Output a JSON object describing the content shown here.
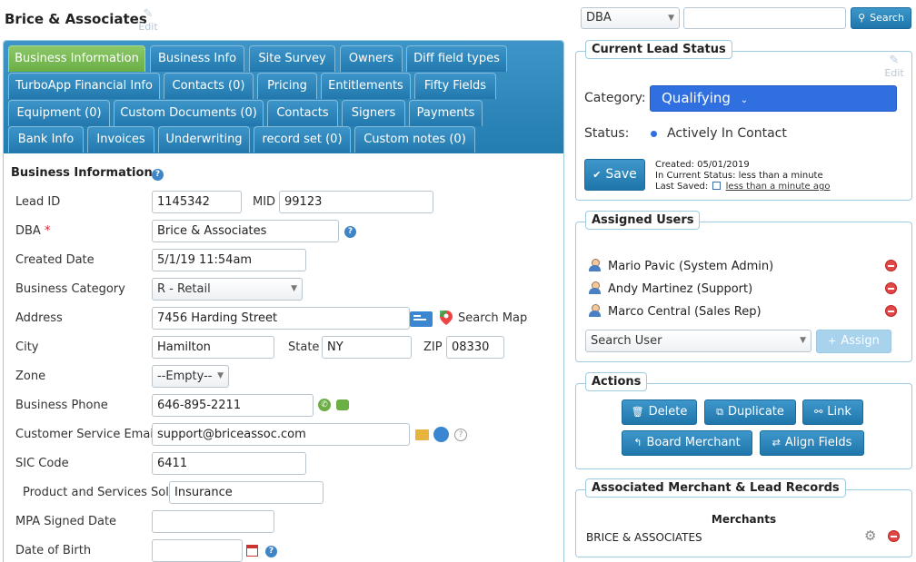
{
  "page": {
    "title": "Brice & Associates",
    "edit_label": "Edit"
  },
  "tabs": [
    {
      "label": "Business Information",
      "active": true
    },
    {
      "label": "Business Info"
    },
    {
      "label": "Site Survey"
    },
    {
      "label": "Owners"
    },
    {
      "label": "Diff field types"
    },
    {
      "label": "TurboApp Financial Info"
    },
    {
      "label": "Contacts (0)"
    },
    {
      "label": "Pricing"
    },
    {
      "label": "Entitlements"
    },
    {
      "label": "Fifty Fields"
    },
    {
      "label": "Equipment (0)"
    },
    {
      "label": "Custom Documents (0)"
    },
    {
      "label": "Contacts"
    },
    {
      "label": "Signers"
    },
    {
      "label": "Payments"
    },
    {
      "label": "Bank Info"
    },
    {
      "label": "Invoices"
    },
    {
      "label": "Underwriting"
    },
    {
      "label": "record set (0)"
    },
    {
      "label": "Custom notes (0)"
    }
  ],
  "form": {
    "section_title": "Business Information",
    "lead_id": {
      "label": "Lead ID",
      "value": "1145342"
    },
    "mid": {
      "label": "MID",
      "value": "99123"
    },
    "dba": {
      "label": "DBA",
      "required_mark": "*",
      "value": "Brice & Associates"
    },
    "created_date": {
      "label": "Created Date",
      "value": "5/1/19 11:54am"
    },
    "business_category": {
      "label": "Business Category",
      "value": "R - Retail"
    },
    "address": {
      "label": "Address",
      "value": "7456 Harding Street",
      "search_map": "Search Map"
    },
    "city": {
      "label": "City",
      "value": "Hamilton"
    },
    "state": {
      "label": "State",
      "value": "NY"
    },
    "zip": {
      "label": "ZIP",
      "value": "08330"
    },
    "zone": {
      "label": "Zone",
      "value": "--Empty--"
    },
    "business_phone": {
      "label": "Business Phone",
      "value": "646-895-2211"
    },
    "customer_service_email": {
      "label": "Customer Service Email",
      "value": "support@briceassoc.com"
    },
    "sic_code": {
      "label": "SIC Code",
      "value": "6411"
    },
    "product_services": {
      "label": "Product and Services Sold",
      "value": "Insurance"
    },
    "mpa_signed_date": {
      "label": "MPA Signed Date",
      "value": ""
    },
    "date_of_birth": {
      "label": "Date of Birth",
      "value": ""
    }
  },
  "search_bar": {
    "field": "DBA",
    "query": "",
    "button": "Search"
  },
  "lead_status": {
    "title": "Current Lead Status",
    "edit_label": "Edit",
    "category_label": "Category:",
    "category_value": "Qualifying",
    "status_label": "Status:",
    "status_value": "Actively In Contact",
    "save_button": "Save",
    "created": "Created: 05/01/2019",
    "in_current_status": "In Current Status: less than a minute",
    "last_saved_label": "Last Saved:",
    "last_saved_value": "less than a minute ago",
    "accent_color": "#2f6fe0"
  },
  "assigned_users": {
    "title": "Assigned Users",
    "users": [
      "Mario Pavic (System Admin)",
      "Andy Martinez (Support)",
      "Marco Central (Sales Rep)"
    ],
    "search_placeholder": "Search User",
    "assign_button": "Assign"
  },
  "actions": {
    "title": "Actions",
    "delete": "Delete",
    "duplicate": "Duplicate",
    "link": "Link",
    "board_merchant": "Board Merchant",
    "align_fields": "Align Fields"
  },
  "associated": {
    "title": "Associated Merchant & Lead Records",
    "merchants_header": "Merchants",
    "merchant_name": "BRICE & ASSOCIATES"
  }
}
